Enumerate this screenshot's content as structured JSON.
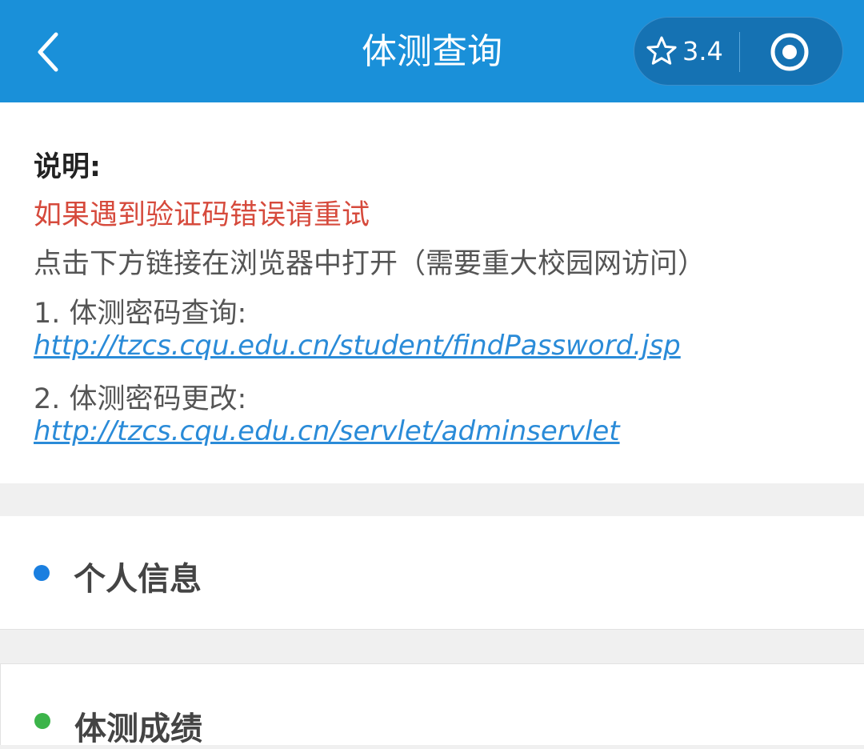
{
  "header": {
    "title": "体测查询",
    "rating": "3.4",
    "bg_color": "#1a90d9"
  },
  "description": {
    "title": "说明:",
    "warning": "如果遇到验证码错误请重试",
    "instruction": "点击下方链接在浏览器中打开（需要重大校园网访问）",
    "item1_label": "1. 体测密码查询:",
    "item1_url": "http://tzcs.cqu.edu.cn/student/findPassword.jsp",
    "item2_label": "2. 体测密码更改:",
    "item2_url": "http://tzcs.cqu.edu.cn/servlet/adminservlet",
    "warning_color": "#d64a3c",
    "link_color": "#2a8bd8"
  },
  "sections": [
    {
      "label": "个人信息",
      "dot_color": "#1a7fe0"
    },
    {
      "label": "体测成绩",
      "dot_color": "#3cb44a"
    }
  ]
}
